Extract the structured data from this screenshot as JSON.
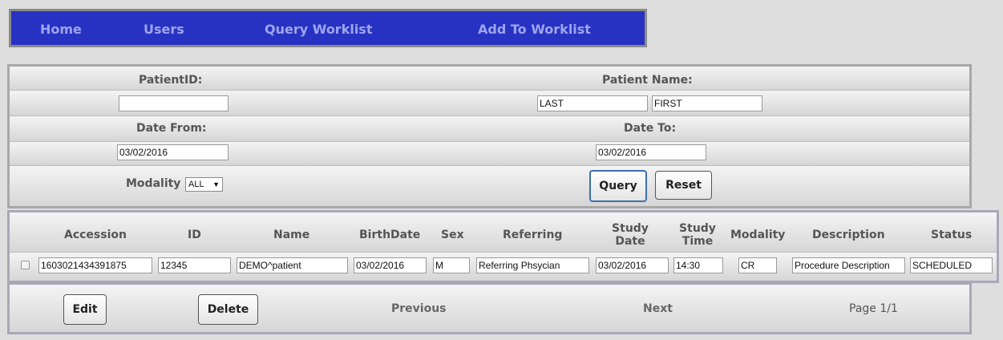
{
  "nav": {
    "items": [
      "Home",
      "Users",
      "Query Worklist",
      "Add To Worklist"
    ]
  },
  "query_form": {
    "patient_id_label": "PatientID:",
    "patient_id_value": "",
    "patient_name_label": "Patient Name:",
    "last_name_value": "LAST",
    "first_name_value": "FIRST",
    "date_from_label": "Date From:",
    "date_from_value": "03/02/2016",
    "date_to_label": "Date To:",
    "date_to_value": "03/02/2016",
    "modality_label": "Modality",
    "modality_selected": "ALL",
    "query_button": "Query",
    "reset_button": "Reset"
  },
  "results": {
    "columns": {
      "accession": "Accession",
      "id": "ID",
      "name": "Name",
      "birthdate": "BirthDate",
      "sex": "Sex",
      "referring": "Referring",
      "study_date_1": "Study",
      "study_date_2": "Date",
      "study_time_1": "Study",
      "study_time_2": "Time",
      "modality": "Modality",
      "description": "Description",
      "status": "Status"
    },
    "rows": [
      {
        "selected": false,
        "accession": "1603021434391875",
        "id": "12345",
        "name": "DEMO^patient",
        "birthdate": "03/02/2016",
        "sex": "M",
        "referring": "Referring Phsycian",
        "study_date": "03/02/2016",
        "study_time": "14:30",
        "modality": "CR",
        "description": "Procedure Description",
        "status": "SCHEDULED"
      }
    ]
  },
  "actions": {
    "edit_button": "Edit",
    "delete_button": "Delete",
    "previous_link": "Previous",
    "next_link": "Next",
    "page_info": "Page 1/1"
  },
  "colors": {
    "nav_background": "#2832c2",
    "nav_text": "#9da6ee",
    "page_background": "#dedede"
  }
}
